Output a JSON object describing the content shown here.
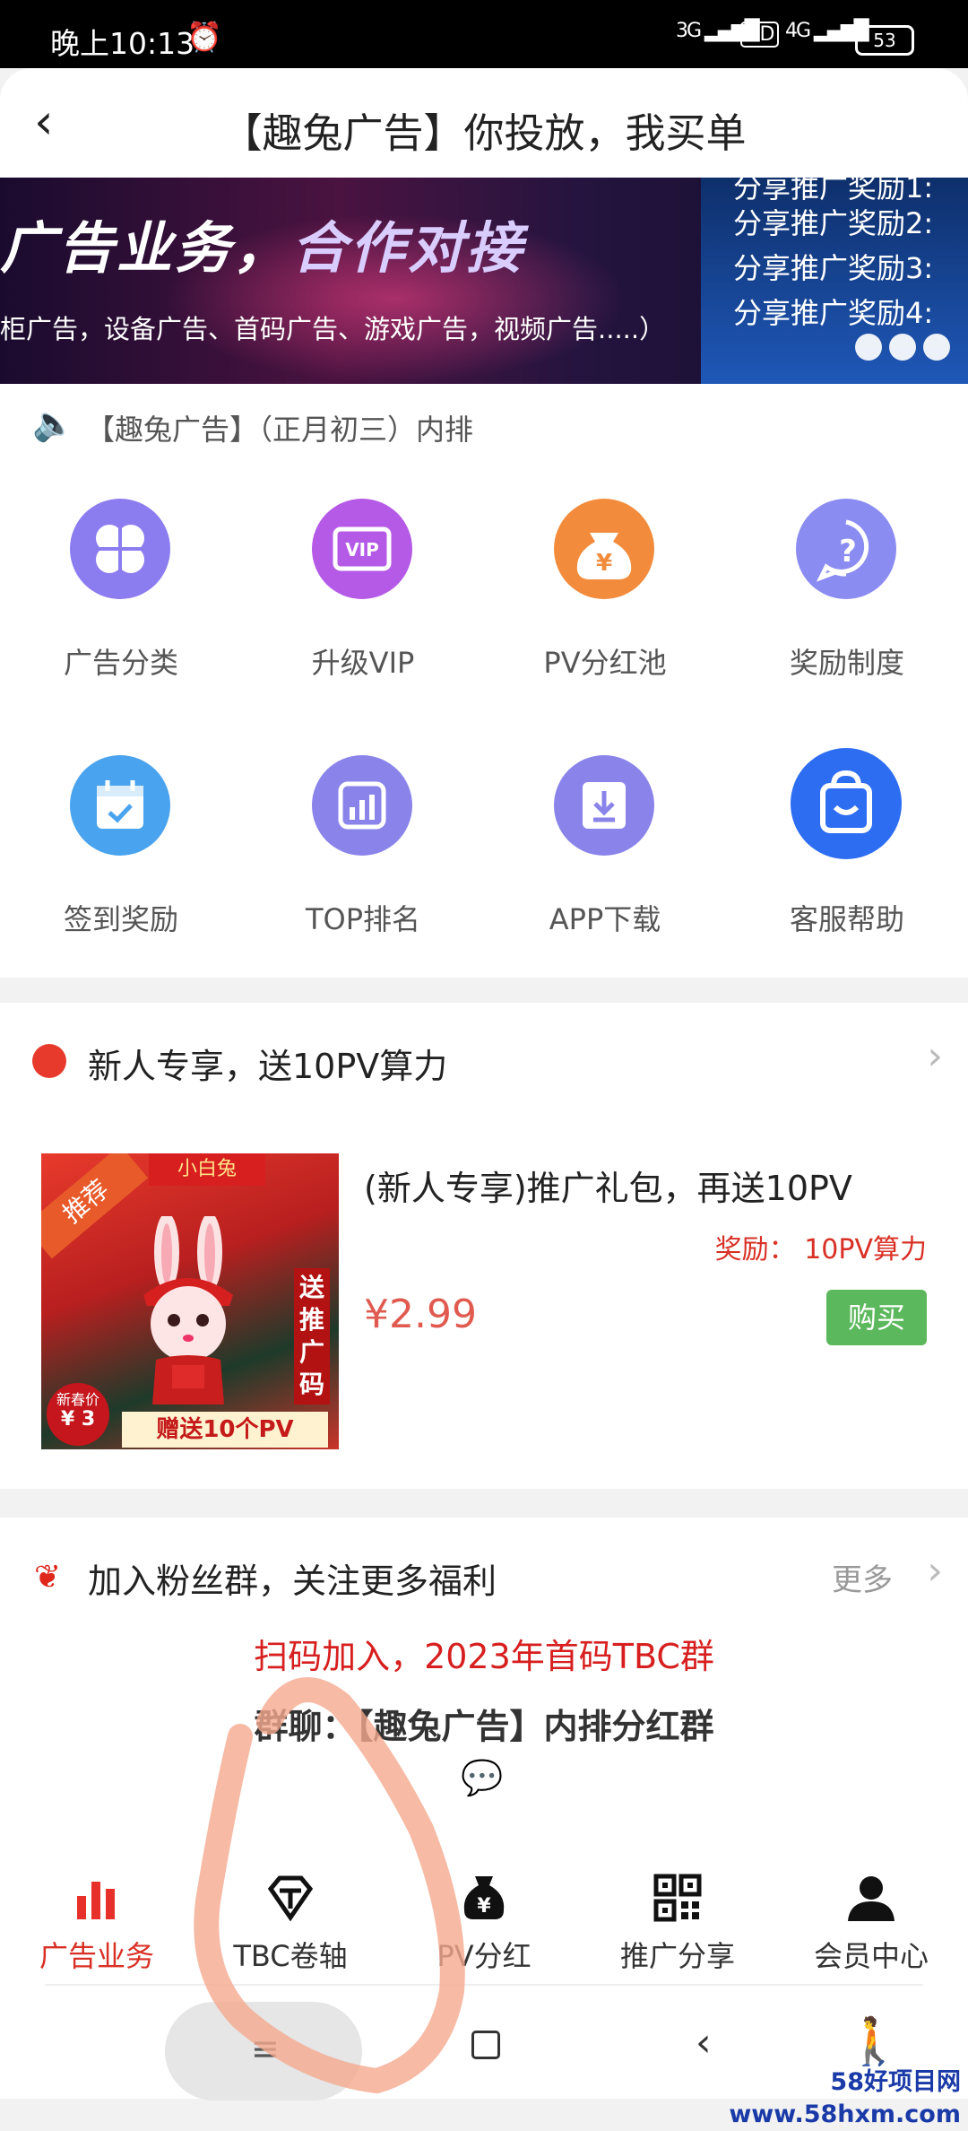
{
  "status_bar": {
    "time": "晚上10:13",
    "alarm_icon": "alarm-icon",
    "signal_1": "3G",
    "hd": "HD",
    "signal_2": "4G",
    "battery": "53"
  },
  "header": {
    "title": "【趣兔广告】你投放，我买单"
  },
  "banner": {
    "headline_a": "广告业务，",
    "headline_b": "合作对接",
    "subline": "柜广告，设备广告、首码广告、游戏广告，视频广告.....）",
    "right_items": [
      "分享推广奖励1:",
      "分享推广奖励2:",
      "分享推广奖励3:",
      "分享推广奖励4:"
    ]
  },
  "notice": {
    "text": "【趣兔广告】（正月初三）内排"
  },
  "grid": [
    {
      "label": "广告分类",
      "icon": "four-petal-icon",
      "color": "#8b7cf0"
    },
    {
      "label": "升级VIP",
      "icon": "vip-icon",
      "color": "#b45ae6"
    },
    {
      "label": "PV分红池",
      "icon": "money-bag-icon",
      "color": "#f28c3c"
    },
    {
      "label": "奖励制度",
      "icon": "question-icon",
      "color": "#8b8cf2"
    },
    {
      "label": "签到奖励",
      "icon": "calendar-check-icon",
      "color": "#4aa3ee"
    },
    {
      "label": "TOP排名",
      "icon": "bar-chart-icon",
      "color": "#8a84ea"
    },
    {
      "label": "APP下载",
      "icon": "download-icon",
      "color": "#8a84ea"
    },
    {
      "label": "客服帮助",
      "icon": "shopping-bag-icon",
      "color": "#2d6df2"
    }
  ],
  "newcomer": {
    "heading": "新人专享，送10PV算力",
    "product_title": "(新人专享)推广礼包，再送10PV",
    "reward": "奖励： 10PV算力",
    "price": "¥2.99",
    "buy_label": "购买",
    "image": {
      "corner_tag": "推荐",
      "top_tag": "小白兔",
      "side_text": "送推广码",
      "bottom_text": "赠送10个PV",
      "price_badge_1": "新春价",
      "price_badge_2": "¥ 3"
    }
  },
  "fans": {
    "heading": "加入粉丝群，关注更多福利",
    "more": "更多",
    "line1": "扫码加入，2023年首码TBC群",
    "line2": "群聊：【趣兔广告】内排分红群"
  },
  "bottom_nav": [
    {
      "label": "广告业务",
      "icon": "bar-chart-icon",
      "active": true
    },
    {
      "label": "TBC卷轴",
      "icon": "diamond-icon",
      "active": false
    },
    {
      "label": "PV分红",
      "icon": "money-bag-icon",
      "active": false
    },
    {
      "label": "推广分享",
      "icon": "qr-code-icon",
      "active": false
    },
    {
      "label": "会员中心",
      "icon": "user-icon",
      "active": false
    }
  ],
  "watermark": "58好项目网www.58hxm.com",
  "colors": {
    "accent_red": "#d93025",
    "buy_green": "#5cb85c",
    "annotation": "#f4a98e"
  }
}
